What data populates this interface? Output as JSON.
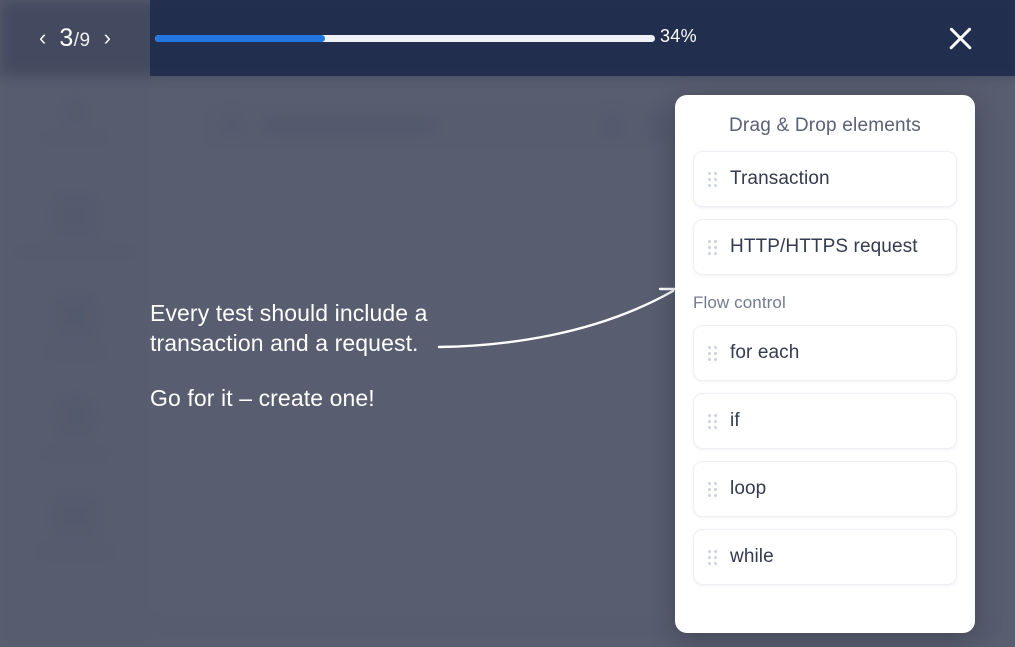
{
  "coach": {
    "nav": {
      "prev_icon": "chevron-left-icon",
      "next_icon": "chevron-right-icon",
      "current_step": "3",
      "separator": "/",
      "total_steps": "9"
    },
    "progress": {
      "percent_label": "34%",
      "percent_value": 34,
      "fill_color": "#2176e0",
      "track_color": "#eef1f5"
    },
    "close_icon": "close-icon",
    "message_line_1": "Every test should include a transaction and a request.",
    "message_line_2": "Go for it – create one!",
    "pointer_icon": "curved-arrow-icon"
  },
  "panel": {
    "title": "Drag & Drop elements",
    "primary_items": [
      {
        "label": "Transaction",
        "handle_icon": "drag-handle-icon"
      },
      {
        "label": "HTTP/HTTPS request",
        "handle_icon": "drag-handle-icon"
      }
    ],
    "section_title": "Flow control",
    "flow_items": [
      {
        "label": "for each",
        "handle_icon": "drag-handle-icon"
      },
      {
        "label": "if",
        "handle_icon": "drag-handle-icon"
      },
      {
        "label": "loop",
        "handle_icon": "drag-handle-icon"
      },
      {
        "label": "while",
        "handle_icon": "drag-handle-icon"
      }
    ]
  },
  "theme": {
    "overlay": "#565a6e",
    "topbar": "#2e3c5c",
    "panel_bg": "#ffffff",
    "text_light": "#ffffff",
    "label_color": "#343b4f"
  }
}
